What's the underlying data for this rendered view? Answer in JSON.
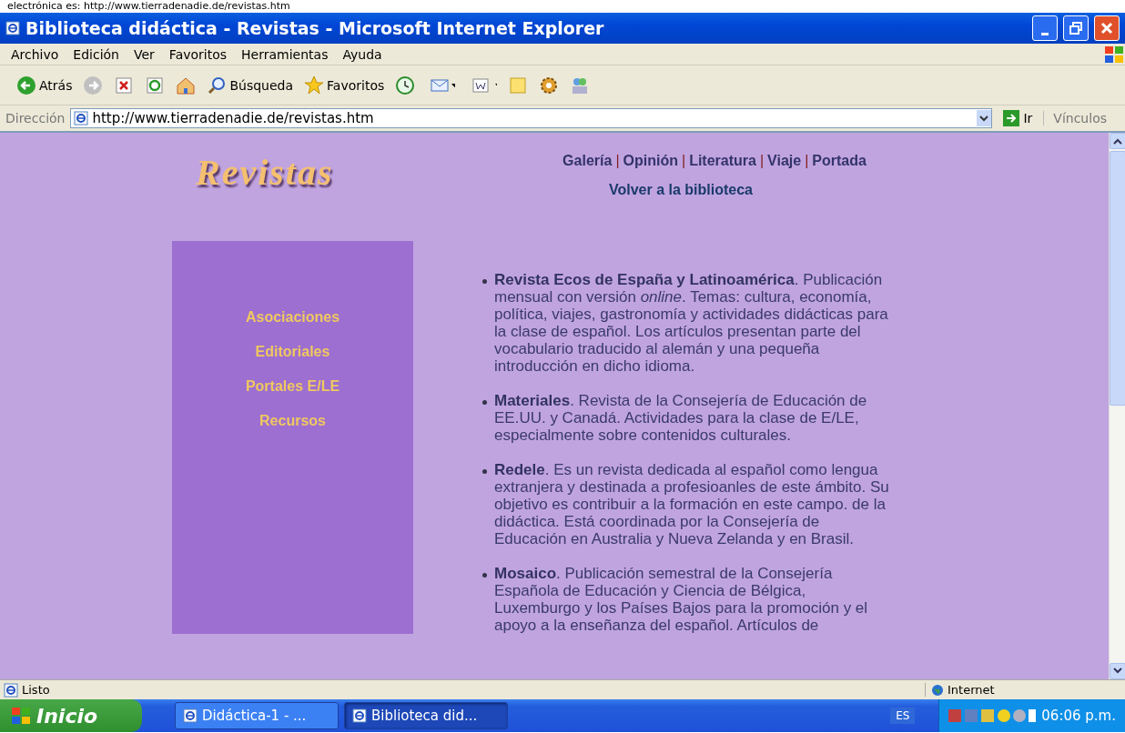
{
  "document_caption": "electrónica es: http://www.tierradenadie.de/revistas.htm",
  "window": {
    "title": "Biblioteca didáctica - Revistas - Microsoft Internet Explorer"
  },
  "menu": [
    "Archivo",
    "Edición",
    "Ver",
    "Favoritos",
    "Herramientas",
    "Ayuda"
  ],
  "toolbar": [
    {
      "kind": "back",
      "label": "Atrás"
    },
    {
      "kind": "forward"
    },
    {
      "kind": "stop"
    },
    {
      "kind": "refresh"
    },
    {
      "kind": "home"
    },
    {
      "kind": "search",
      "label": "Búsqueda"
    },
    {
      "kind": "favorites",
      "label": "Favoritos"
    },
    {
      "kind": "history"
    },
    {
      "kind": "mail"
    },
    {
      "kind": "word"
    },
    {
      "kind": "folder"
    },
    {
      "kind": "gear"
    },
    {
      "kind": "messenger"
    }
  ],
  "address": {
    "label": "Dirección",
    "value": "http://www.tierradenadie.de/revistas.htm",
    "go": "Ir",
    "links": "Vínculos"
  },
  "page": {
    "heading": "Revistas",
    "nav": [
      "Galería",
      "Opinión",
      "Literatura",
      "Viaje",
      "Portada"
    ],
    "nav_separator": "|",
    "back_link": "Volver a la biblioteca",
    "sidebar": [
      "Asociaciones",
      "Editoriales",
      "Portales E/LE",
      "Recursos"
    ],
    "entries": [
      {
        "text": "**Revista Ecos de España y Latinoamérica**. Publicación mensual con versión *online*. Temas: cultura, economía, política, viajes, gastronomía y actividades didácticas para la clase de español. Los artículos presentan parte del vocabulario traducido al alemán y una pequeña introducción en dicho idioma."
      },
      {
        "text": "**Materiales**. Revista de la Consejería de Educación de EE.UU. y Canadá. Actividades para la clase de E/LE, especialmente sobre contenidos culturales."
      },
      {
        "text": "**Redele**. Es un revista dedicada al español como lengua extranjera y destinada a profesioanles de este ámbito. Su objetivo es contribuir a la formación en este campo. de la didáctica. Está coordinada por la Consejería de Educación en Australia y Nueva Zelanda y en Brasil."
      },
      {
        "text": "**Mosaico**. Publicación semestral de la Consejería Española de Educación y Ciencia de Bélgica, Luxemburgo y los Países Bajos para la promoción y el apoyo a la enseñanza del español. Artículos de"
      }
    ]
  },
  "status_bar": {
    "text": "Listo",
    "zone": "Internet"
  },
  "taskbar": {
    "start": "Inicio",
    "tasks": [
      {
        "label": "Didáctica-1 - ...",
        "selected": false
      },
      {
        "label": "Biblioteca did...",
        "selected": true
      }
    ],
    "language": "ES",
    "clock": "06:06 p.m."
  }
}
